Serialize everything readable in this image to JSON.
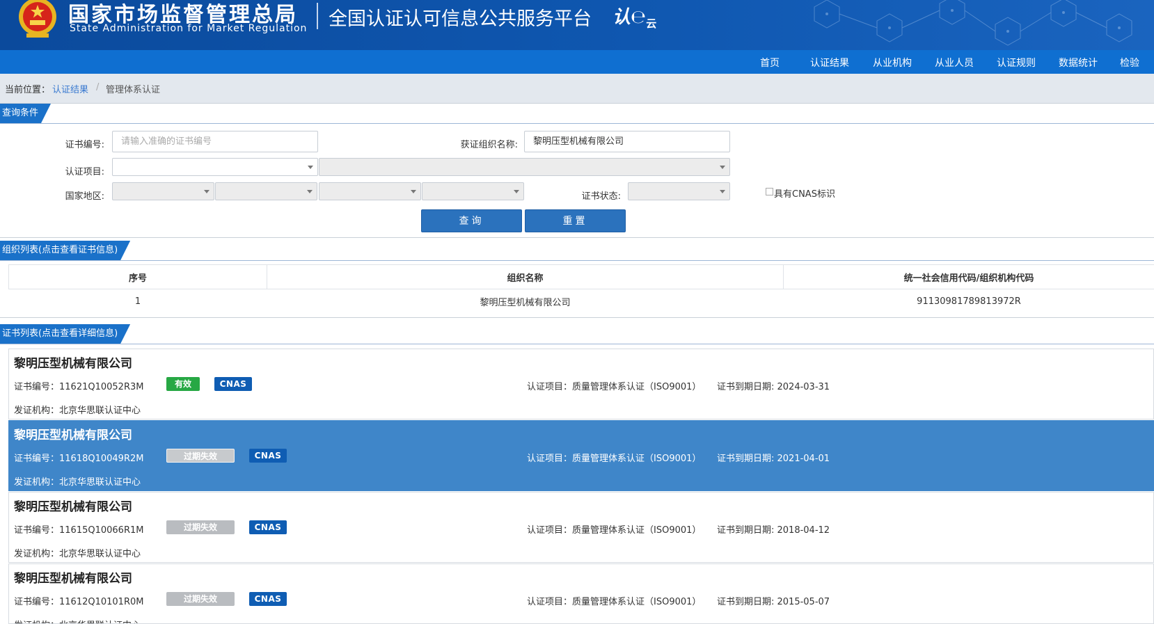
{
  "header": {
    "agency_cn": "国家市场监督管理总局",
    "agency_en": "State Administration  for  Market Regulation",
    "platform_name": "全国认证认可信息公共服务平台",
    "logo_text": "认",
    "logo_sub": "云",
    "emblem_icon": "national-emblem-icon",
    "colors": {
      "header_bg": "#0f57b0",
      "nav_bg": "#0f6fd1",
      "accent": "#1a71c9"
    }
  },
  "nav": {
    "items": [
      {
        "label": "首页"
      },
      {
        "label": "认证结果"
      },
      {
        "label": "从业机构"
      },
      {
        "label": "从业人员"
      },
      {
        "label": "认证规则"
      },
      {
        "label": "数据统计"
      },
      {
        "label": "检验"
      }
    ]
  },
  "breadcrumb": {
    "prefix": "当前位置：",
    "link": "认证结果",
    "separator": "/",
    "current": "管理体系认证"
  },
  "query": {
    "section_title": "查询条件",
    "cert_no_label": "证书编号:",
    "cert_no_placeholder": "请输入准确的证书编号",
    "org_name_label": "获证组织名称:",
    "org_name_value": "黎明压型机械有限公司",
    "project_label": "认证项目:",
    "region_label": "国家地区:",
    "status_label": "证书状态:",
    "cnas_label": "具有CNAS标识",
    "query_button": "查询",
    "reset_button": "重置"
  },
  "org_list": {
    "section_title": "组织列表(点击查看证书信息)",
    "columns": [
      "序号",
      "组织名称",
      "统一社会信用代码/组织机构代码"
    ],
    "rows": [
      {
        "index": "1",
        "name": "黎明压型机械有限公司",
        "code": "91130981789813972R"
      }
    ]
  },
  "cert_list": {
    "section_title": "证书列表(点击查看详细信息)",
    "items": [
      {
        "org": "黎明压型机械有限公司",
        "cert_no": "证书编号：11621Q10052R3M",
        "status": "有效",
        "mark": "CNAS",
        "issuer": "发证机构：北京华思联认证中心",
        "project": "认证项目：质量管理体系认证（ISO9001）",
        "expiry": "证书到期日期: 2024-03-31"
      },
      {
        "org": "黎明压型机械有限公司",
        "cert_no": "证书编号：11618Q10049R2M",
        "status": "过期失效",
        "mark": "CNAS",
        "issuer": "发证机构：北京华思联认证中心",
        "project": "认证项目：质量管理体系认证（ISO9001）",
        "expiry": "证书到期日期: 2021-04-01"
      },
      {
        "org": "黎明压型机械有限公司",
        "cert_no": "证书编号：11615Q10066R1M",
        "status": "过期失效",
        "mark": "CNAS",
        "issuer": "发证机构：北京华思联认证中心",
        "project": "认证项目：质量管理体系认证（ISO9001）",
        "expiry": "证书到期日期: 2018-04-12"
      },
      {
        "org": "黎明压型机械有限公司",
        "cert_no": "证书编号：11612Q10101R0M",
        "status": "过期失效",
        "mark": "CNAS",
        "issuer": "发证机构：北京华思联认证中心",
        "project": "认证项目：质量管理体系认证（ISO9001）",
        "expiry": "证书到期日期: 2015-05-07"
      }
    ]
  }
}
